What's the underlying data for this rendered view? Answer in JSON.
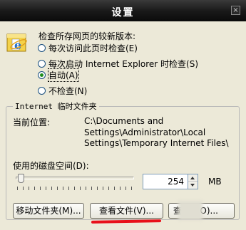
{
  "window": {
    "title": "设置",
    "close_glyph": "×"
  },
  "icons": {
    "ie": "internet-explorer-icon"
  },
  "check_header": "检查所存网页的较新版本:",
  "radio_options": [
    {
      "label": "每次访问此页时检查(E)",
      "checked": false
    },
    {
      "label": "每次启动 Internet Explorer 时检查(S)",
      "checked": false
    },
    {
      "label": "自动(A)",
      "checked": true
    },
    {
      "label": "不检查(N)",
      "checked": false
    }
  ],
  "temp_folder": {
    "group_title": "Internet 临时文件夹",
    "location_label": "当前位置:",
    "location_value": "C:\\Documents and Settings\\Administrator\\Local Settings\\Temporary Internet Files\\",
    "disk_space_label": "使用的磁盘空间(D):",
    "disk_space_value": "254",
    "unit": "MB"
  },
  "buttons": {
    "move_folder": "移动文件夹(M)...",
    "view_files": "查看文件(V)...",
    "view_objects_prefix": "查",
    "view_objects_suffix": "(O)..."
  },
  "colors": {
    "titlebar": "#1a1a1a",
    "window_bg": "#ece9d8",
    "radio_checked": "#1e8c1e",
    "annotation_red": "#e8101a"
  }
}
